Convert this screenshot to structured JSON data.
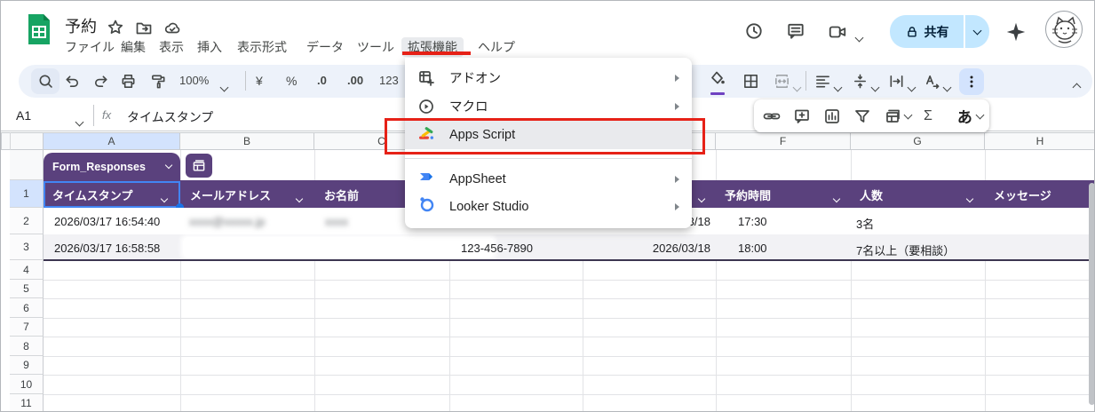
{
  "window": {
    "title": "予約"
  },
  "menubar": {
    "items": [
      "ファイル",
      "編集",
      "表示",
      "挿入",
      "表示形式",
      "データ",
      "ツール",
      "拡張機能",
      "ヘルプ"
    ],
    "active_item": "拡張機能"
  },
  "header_actions": {
    "share_label": "共有"
  },
  "toolbar": {
    "zoom_value": "100%",
    "currency": "¥",
    "percent": "%",
    "decimal_decrease": ".0",
    "decimal_increase": ".00",
    "format_123": "123",
    "sum": "Σ",
    "ime_toggle": "あ"
  },
  "formula_bar": {
    "cell_reference": "A1",
    "fx_label": "fx",
    "value": "タイムスタンプ"
  },
  "extensions_menu": {
    "items": [
      {
        "label": "アドオン",
        "has_submenu": true
      },
      {
        "label": "マクロ",
        "has_submenu": true
      },
      {
        "label": "Apps Script",
        "has_submenu": false,
        "highlighted": true
      },
      {
        "label": "AppSheet",
        "has_submenu": true
      },
      {
        "label": "Looker Studio",
        "has_submenu": true
      }
    ]
  },
  "sheet": {
    "table_name": "Form_Responses",
    "column_letters": [
      "A",
      "B",
      "C",
      "F",
      "G",
      "H"
    ],
    "row1_number": "1",
    "header_row": {
      "col_a": "タイムスタンプ",
      "col_b": "メールアドレス",
      "col_c": "お名前",
      "col_f": "予約時間",
      "col_g": "人数",
      "col_h": "メッセージ"
    },
    "rows": [
      {
        "row_number": "2",
        "timestamp": "2026/03/17 16:54:40",
        "email_redacted": "xxxx@xxxxx.jp",
        "name_redacted": "xxxx",
        "reservation_date": "2026/03/18",
        "reservation_time": "17:30",
        "party_size": "3名"
      },
      {
        "row_number": "3",
        "timestamp": "2026/03/17 16:58:58",
        "phone": "123-456-7890",
        "reservation_date": "2026/03/18",
        "reservation_time": "18:00",
        "party_size": "7名以上（要相談）"
      }
    ],
    "empty_row_numbers": [
      "4",
      "5",
      "6",
      "7",
      "8",
      "9",
      "10",
      "11"
    ]
  },
  "colors": {
    "table_header_purple": "#5a417d",
    "selection_blue": "#4285f4",
    "share_pill_blue": "#c2e7ff",
    "annotation_red": "#e62117",
    "row_banding": "#f2f2f5"
  }
}
